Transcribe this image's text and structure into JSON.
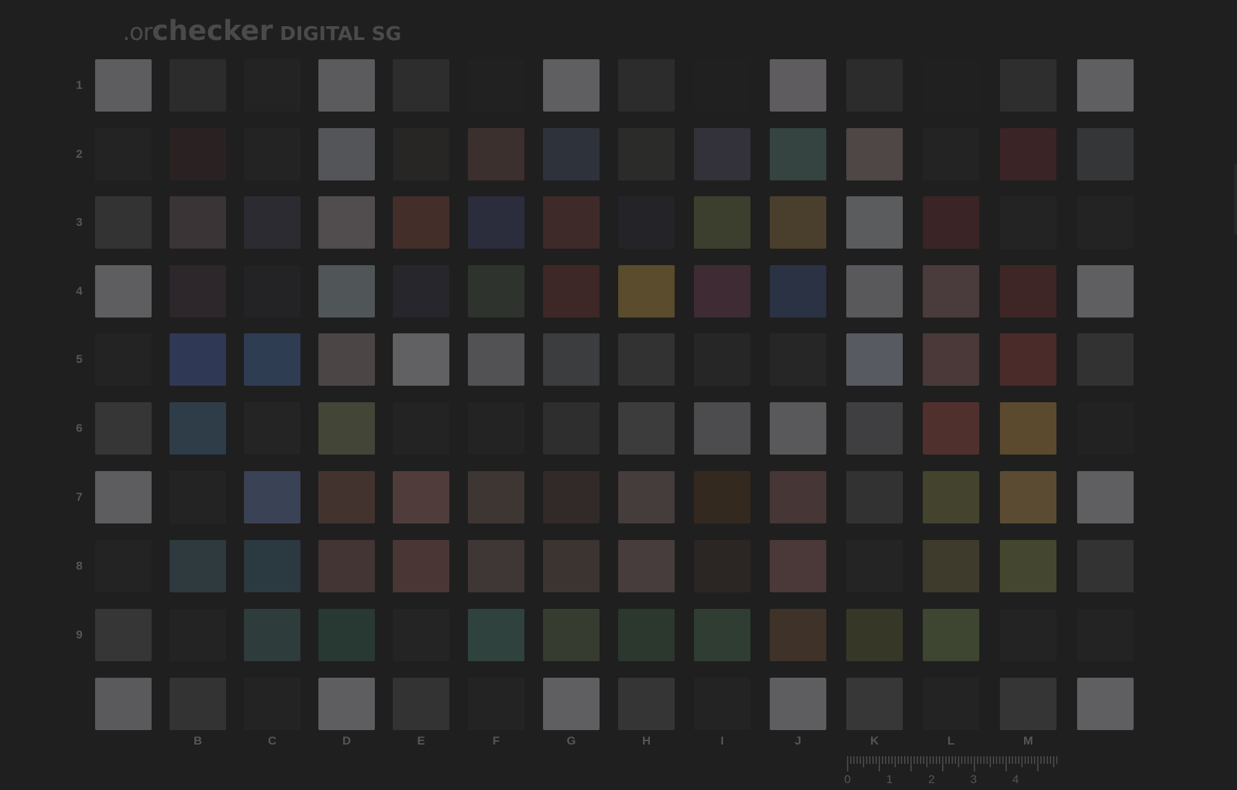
{
  "logo": {
    "part1": ".or",
    "part2": "checker",
    "part3": "DIGITAL SG"
  },
  "row_labels": [
    "1",
    "2",
    "3",
    "4",
    "5",
    "6",
    "7",
    "8",
    "9"
  ],
  "column_labels": [
    "B",
    "C",
    "D",
    "E",
    "F",
    "G",
    "H",
    "I",
    "J",
    "K",
    "L",
    "M"
  ],
  "ruler_numbers": [
    "0",
    "1",
    "2",
    "3",
    "4"
  ],
  "colors": {
    "background": "#1f1f1f",
    "label": "#565656"
  },
  "patches": [
    [
      "#5d5d5f",
      "#2c2c2c",
      "#232323",
      "#5b5a5c",
      "#2d2d2d",
      "#212121",
      "#5f5f61",
      "#2c2c2c",
      "#202020",
      "#5e5c5f",
      "#2c2c2c",
      "#202020",
      "#2e2e2e",
      "#5f5f61"
    ],
    [
      "#232323",
      "#2a2222",
      "#232323",
      "#545558",
      "#272624",
      "#3b302e",
      "#2e323b",
      "#2b2c2a",
      "#33323a",
      "#354341",
      "#4e4745",
      "#232323",
      "#3a2426",
      "#343638"
    ],
    [
      "#333333",
      "#3b3437",
      "#2c2b32",
      "#514d4f",
      "#432e2a",
      "#2b2c3c",
      "#3f2a2a",
      "#242428",
      "#3d3f2e",
      "#4a3f2c",
      "#5b5c5e",
      "#3b2425",
      "#232323",
      "#232323"
    ],
    [
      "#5e5d5f",
      "#2d262b",
      "#232325",
      "#505558",
      "#26262c",
      "#2e332d",
      "#3e2727",
      "#5a4c2c",
      "#3e2b33",
      "#2a3244",
      "#59595c",
      "#4a3b3c",
      "#3e2626",
      "#5f5f61"
    ],
    [
      "#232323",
      "#2f3854",
      "#2f3d53",
      "#4b4545",
      "#616163",
      "#525254",
      "#3c3d3f",
      "#323233",
      "#262626",
      "#262626",
      "#575a60",
      "#4a3938",
      "#4a2b29",
      "#323232"
    ],
    [
      "#363636",
      "#2f3d48",
      "#242424",
      "#434536",
      "#232323",
      "#232323",
      "#2e2e2e",
      "#3c3c3d",
      "#4c4c4e",
      "#59595b",
      "#3f3f41",
      "#4f302d",
      "#5c4a2f",
      "#222222"
    ],
    [
      "#5d5d5f",
      "#232323",
      "#3a4256",
      "#43332e",
      "#503d3b",
      "#3d3632",
      "#322a28",
      "#453c3c",
      "#33291f",
      "#463636",
      "#323232",
      "#44432e",
      "#5a4b32",
      "#5f5f61"
    ],
    [
      "#232323",
      "#2e3a3e",
      "#2b3940",
      "#423533",
      "#4b3636",
      "#3e3735",
      "#3c3431",
      "#473d3c",
      "#2b2524",
      "#4b3838",
      "#242424",
      "#3f3b2c",
      "#454630",
      "#333333"
    ],
    [
      "#363636",
      "#232323",
      "#2e3c3b",
      "#283833",
      "#242424",
      "#30423e",
      "#363d30",
      "#2c372d",
      "#2f3d32",
      "#3f3228",
      "#373728",
      "#3e4530",
      "#232323",
      "#232323"
    ],
    [
      "#5a5a5c",
      "#333333",
      "#232323",
      "#5e5e60",
      "#333333",
      "#232323",
      "#5f5f61",
      "#353535",
      "#232323",
      "#5e5e60",
      "#373737",
      "#232323",
      "#353535",
      "#5f5f61"
    ]
  ]
}
